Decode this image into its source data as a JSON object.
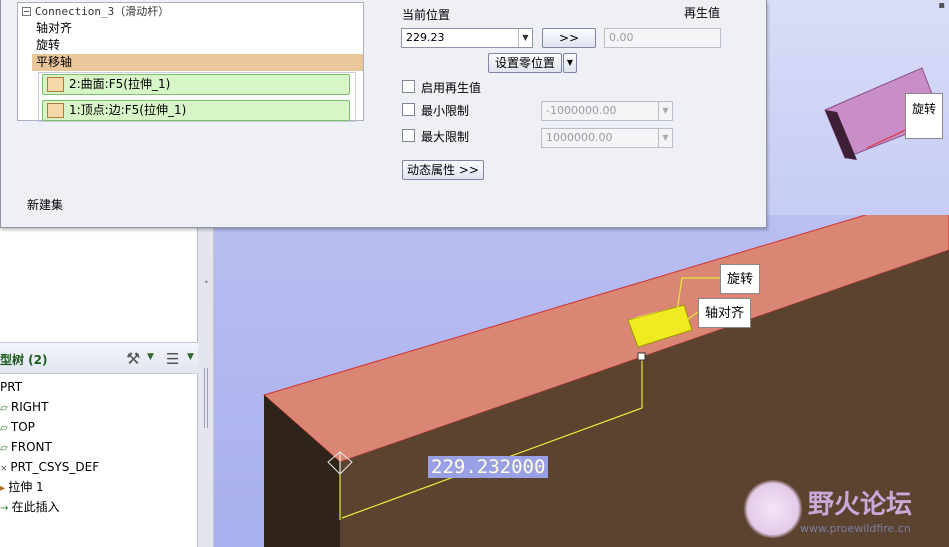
{
  "dialog": {
    "connection_tree": {
      "root_label": "Connection_3（滑动杆）",
      "items": [
        "轴对齐",
        "旋转",
        "平移轴"
      ],
      "selected_item": "平移轴",
      "references": [
        "2:曲面:F5(拉伸_1)",
        "1:顶点:边:F5(拉伸_1)"
      ]
    },
    "new_set_label": "新建集",
    "current_position_label": "当前位置",
    "current_position_value": "229.23",
    "regen_value_label": "再生值",
    "regen_button_label": ">>",
    "regen_value": "0.00",
    "set_zero_button_label": "设置零位置",
    "enable_regen_label": "启用再生值",
    "min_limit_label": "最小限制",
    "min_limit_value": "-1000000.00",
    "max_limit_label": "最大限制",
    "max_limit_value": "1000000.00",
    "dynamic_props_label": "动态属性 >>"
  },
  "model_tree": {
    "title": "型树 (2)",
    "items": [
      "PRT",
      "RIGHT",
      "TOP",
      "FRONT",
      "PRT_CSYS_DEF",
      "拉伸 1",
      "在此插入"
    ]
  },
  "viewport": {
    "dimension_value": "229.232000",
    "callouts": [
      "旋转",
      "轴对齐"
    ],
    "top_callout": "旋转"
  },
  "watermark": {
    "text": "野火论坛",
    "url": "www.proewildfire.cn"
  },
  "colors": {
    "accent_selected": "#e9c79a",
    "reference_fill": "#d8f5c8",
    "solid_top": "#d98675",
    "solid_side": "#5b4330"
  }
}
